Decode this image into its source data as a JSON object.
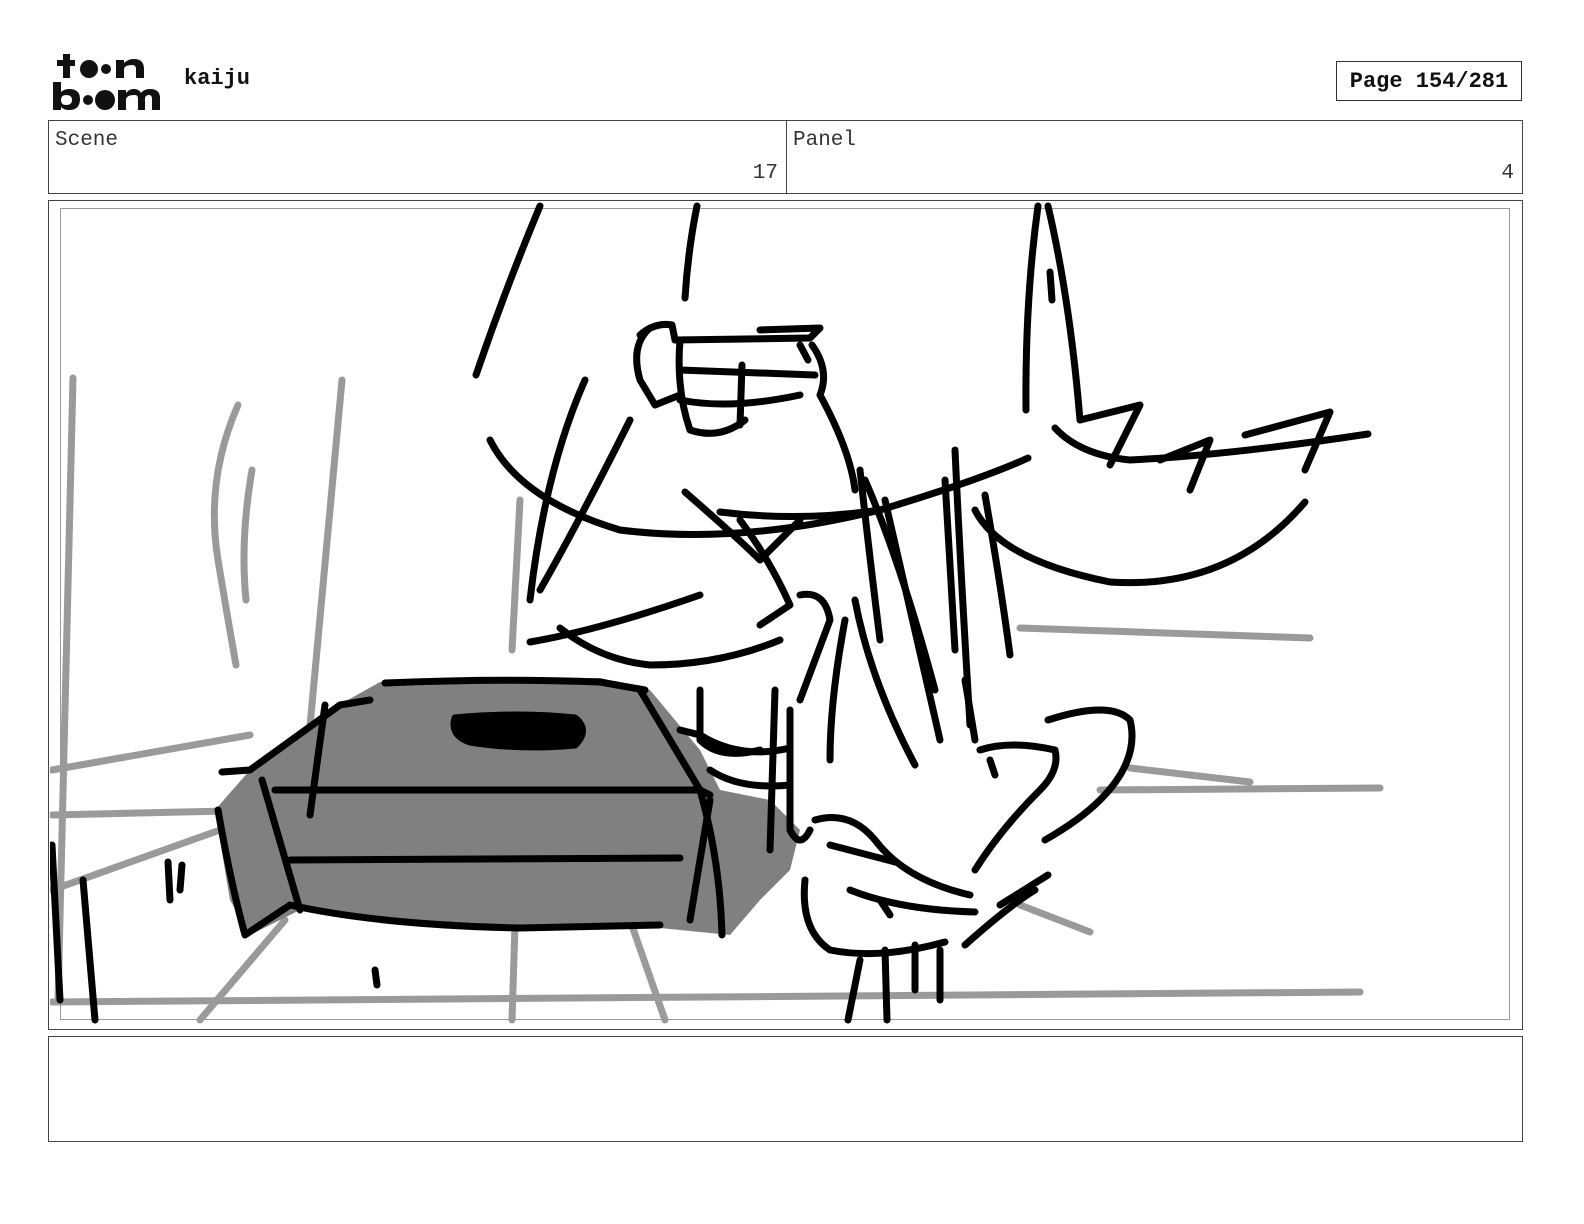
{
  "header": {
    "logo_text": "toon boom",
    "project_title": "kaiju",
    "page_indicator": "Page 154/281"
  },
  "info": {
    "scene_label": "Scene",
    "scene_number": "17",
    "panel_label": "Panel",
    "panel_number": "4"
  },
  "notes": {
    "text": ""
  },
  "colors": {
    "sketch_ink": "#000000",
    "sketch_tone": "#808080",
    "sketch_guides": "#9a9a9a",
    "border": "#444444"
  }
}
